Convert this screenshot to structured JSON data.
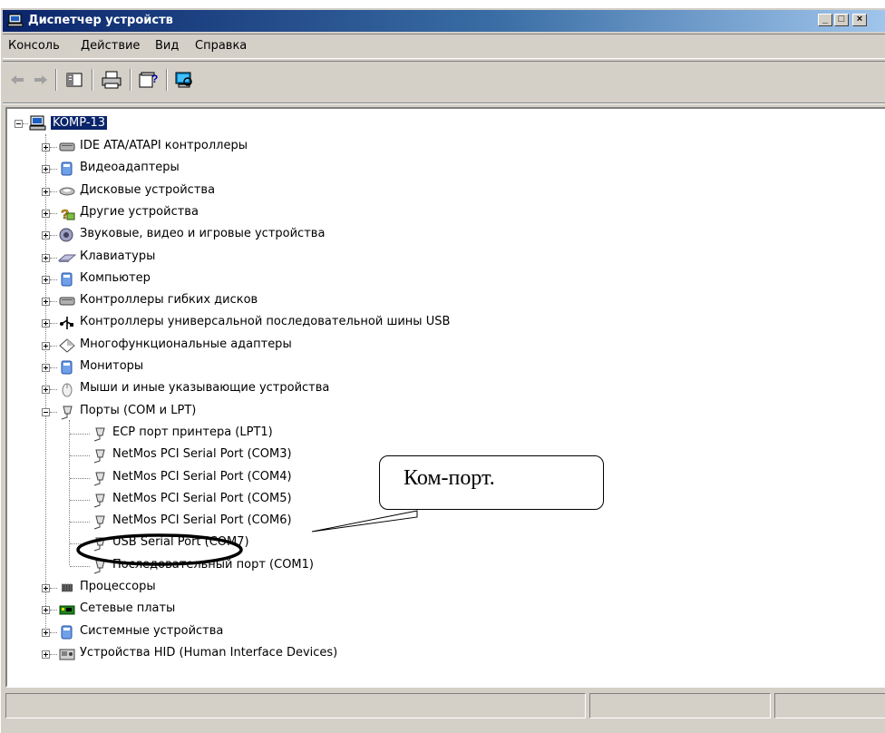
{
  "window": {
    "title": "Диспетчер устройств",
    "caption_buttons": [
      "_",
      "□",
      "×"
    ]
  },
  "menu": [
    "Консоль",
    "Действие",
    "Вид",
    "Справка"
  ],
  "toolbar": [
    "back-icon",
    "forward-icon",
    "properties-icon",
    "print-icon",
    "help-icon",
    "scan-hardware-icon"
  ],
  "tree": {
    "root": "KOMP-13",
    "categories": [
      {
        "label": "IDE ATA/ATAPI контроллеры",
        "icon": "ide-controller-icon"
      },
      {
        "label": "Видеоадаптеры",
        "icon": "display-adapter-icon"
      },
      {
        "label": "Дисковые устройства",
        "icon": "disk-drive-icon"
      },
      {
        "label": "Другие устройства",
        "icon": "unknown-device-icon"
      },
      {
        "label": "Звуковые, видео и игровые устройства",
        "icon": "sound-icon"
      },
      {
        "label": "Клавиатуры",
        "icon": "keyboard-icon"
      },
      {
        "label": "Компьютер",
        "icon": "computer-icon"
      },
      {
        "label": "Контроллеры гибких дисков",
        "icon": "floppy-controller-icon"
      },
      {
        "label": "Контроллеры универсальной последовательной шины USB",
        "icon": "usb-icon"
      },
      {
        "label": "Многофункциональные адаптеры",
        "icon": "multifunction-icon"
      },
      {
        "label": "Мониторы",
        "icon": "monitor-icon"
      },
      {
        "label": "Мыши и иные указывающие устройства",
        "icon": "mouse-icon"
      },
      {
        "label": "Порты (COM и LPT)",
        "icon": "port-icon",
        "expanded": true
      },
      {
        "label": "Процессоры",
        "icon": "processor-icon"
      },
      {
        "label": "Сетевые платы",
        "icon": "network-card-icon"
      },
      {
        "label": "Системные устройства",
        "icon": "system-device-icon"
      },
      {
        "label": "Устройства HID (Human Interface Devices)",
        "icon": "hid-icon"
      }
    ],
    "ports": [
      "ECP порт принтера (LPT1)",
      "NetMos PCI Serial Port (COM3)",
      "NetMos PCI Serial Port (COM4)",
      "NetMos PCI Serial Port (COM5)",
      "NetMos PCI Serial Port (COM6)",
      "USB Serial Port (COM7)",
      "Последовательный порт (COM1)"
    ]
  },
  "callout": {
    "text": "Ком-порт.",
    "target": "USB Serial Port (COM7)"
  },
  "colors": {
    "titlebar": "#0a246a",
    "face": "#d4d0c8",
    "selection": "#0a246a"
  }
}
